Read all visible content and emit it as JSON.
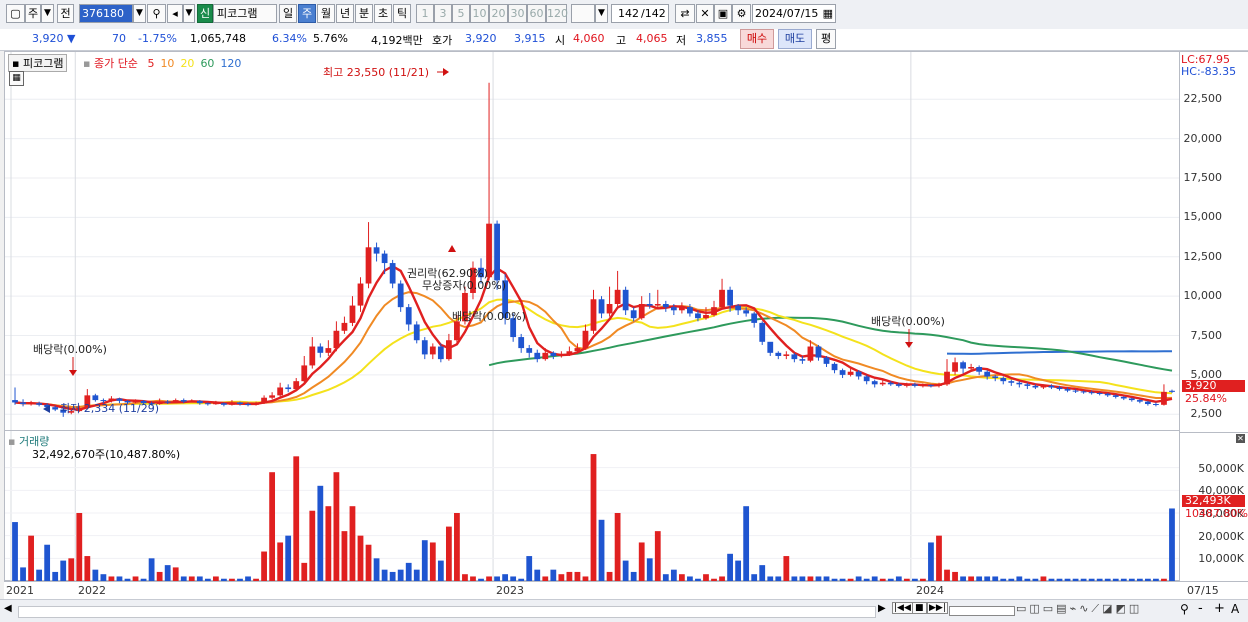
{
  "toolbar": {
    "period_week": "주",
    "prev_label": "전",
    "stock_code": "376180",
    "credit_badge": "신",
    "stock_name": "피코그램",
    "periods": [
      "일",
      "주",
      "월",
      "년",
      "분",
      "초",
      "틱"
    ],
    "active_period": "주",
    "intervals": [
      "1",
      "3",
      "5",
      "10",
      "20",
      "30",
      "60",
      "120"
    ],
    "count": "142",
    "count_total": "/142",
    "date": "2024/07/15"
  },
  "quote": {
    "price": "3,920",
    "direction": "▼",
    "change": "70",
    "change_pct": "-1.75%",
    "volume": "1,065,748",
    "turnover_pct": "6.34%",
    "pct2": "5.76%",
    "amount": "4,192백만",
    "ask_label": "호가",
    "ask": "3,920",
    "bid": "3,915",
    "open_label": "시",
    "open": "4,060",
    "high_label": "고",
    "high": "4,065",
    "low_label": "저",
    "low": "3,855",
    "buy_button": "매수",
    "sell_button": "매도",
    "eval_button": "평"
  },
  "chart": {
    "name_tab": "피코그램",
    "ma_label": "종가 단순",
    "ma_periods": [
      "5",
      "10",
      "20",
      "60",
      "120"
    ],
    "ma_colors": [
      "#e02020",
      "#f08a24",
      "#f4e21c",
      "#2e9a5c",
      "#2f6fd0"
    ],
    "max_annotation": "최고 23,550 (11/21)",
    "min_annotation": "최저 2,334 (11/29)",
    "annotations": [
      "배당락(0.00%)",
      "권리락(62.90%)",
      "무상증자(0.00%)",
      "배당락(0.00%)",
      "배당락(0.00%)"
    ],
    "lc": "LC:67.95",
    "hc": "HC:-83.35",
    "current_price_tag": "3,920",
    "current_pct_tag": "25.84%",
    "volume_title": "거래량",
    "volume_value": "32,492,670주(10,487.80%)",
    "volume_tag": "32,493K",
    "volume_pct_tag": "10487.80%"
  },
  "chart_data": {
    "type": "candlestick",
    "title": "피코그램",
    "price_ticks": [
      "22,500",
      "20,000",
      "17,500",
      "15,000",
      "12,500",
      "10,000",
      "7,500",
      "5,000",
      "2,500"
    ],
    "volume_ticks": [
      "50,000K",
      "40,000K",
      "30,000K",
      "20,000K",
      "10,000K"
    ],
    "x_labels": [
      "2021",
      "2022",
      "2023",
      "2024",
      "07/15"
    ],
    "ylim": [
      1500,
      25500
    ],
    "candles": [
      [
        3400,
        3250,
        4200,
        3100
      ],
      [
        3250,
        3150,
        3450,
        3000
      ],
      [
        3150,
        3200,
        3350,
        3050
      ],
      [
        3200,
        3100,
        3300,
        3000
      ],
      [
        3100,
        2950,
        3200,
        2850
      ],
      [
        2950,
        2800,
        3050,
        2700
      ],
      [
        2800,
        2600,
        2900,
        2334
      ],
      [
        2600,
        2700,
        2800,
        2500
      ],
      [
        2700,
        2900,
        3050,
        2650
      ],
      [
        2900,
        3700,
        4100,
        2850
      ],
      [
        3700,
        3400,
        3800,
        3300
      ],
      [
        3400,
        3350,
        3500,
        3200
      ],
      [
        3350,
        3500,
        3650,
        3250
      ],
      [
        3500,
        3350,
        3550,
        3200
      ],
      [
        3350,
        3250,
        3400,
        3150
      ],
      [
        3250,
        3350,
        3450,
        3200
      ],
      [
        3350,
        3200,
        3400,
        3100
      ],
      [
        3200,
        3150,
        3300,
        3050
      ],
      [
        3150,
        3300,
        3500,
        3100
      ],
      [
        3300,
        3250,
        3400,
        3150
      ],
      [
        3250,
        3400,
        3500,
        3200
      ],
      [
        3400,
        3300,
        3500,
        3200
      ],
      [
        3300,
        3350,
        3450,
        3250
      ],
      [
        3350,
        3200,
        3400,
        3100
      ],
      [
        3200,
        3150,
        3250,
        3050
      ],
      [
        3150,
        3200,
        3350,
        3100
      ],
      [
        3200,
        3100,
        3250,
        3000
      ],
      [
        3100,
        3250,
        3400,
        3050
      ],
      [
        3250,
        3150,
        3300,
        3050
      ],
      [
        3150,
        3100,
        3250,
        3000
      ],
      [
        3100,
        3200,
        3300,
        3050
      ],
      [
        3200,
        3550,
        3700,
        3150
      ],
      [
        3550,
        3700,
        3900,
        3450
      ],
      [
        3700,
        4200,
        4500,
        3600
      ],
      [
        4200,
        4100,
        4400,
        3900
      ],
      [
        4100,
        4600,
        4800,
        4000
      ],
      [
        4600,
        5600,
        6200,
        4500
      ],
      [
        5600,
        6800,
        7400,
        5400
      ],
      [
        6800,
        6400,
        7000,
        6100
      ],
      [
        6400,
        6700,
        7200,
        6200
      ],
      [
        6700,
        7800,
        8400,
        6500
      ],
      [
        7800,
        8300,
        8700,
        7600
      ],
      [
        8300,
        9400,
        10000,
        8100
      ],
      [
        9400,
        10800,
        11200,
        9000
      ],
      [
        10800,
        13100,
        14700,
        10500
      ],
      [
        13100,
        12700,
        13400,
        12200
      ],
      [
        12700,
        12100,
        12900,
        11400
      ],
      [
        12100,
        10800,
        12300,
        10500
      ],
      [
        10800,
        9300,
        11000,
        9000
      ],
      [
        9300,
        8200,
        9500,
        7800
      ],
      [
        8200,
        7200,
        8400,
        7000
      ],
      [
        7200,
        6300,
        7400,
        6000
      ],
      [
        6300,
        6800,
        7000,
        6000
      ],
      [
        6800,
        6000,
        7000,
        5800
      ],
      [
        6000,
        7200,
        7600,
        5900
      ],
      [
        7200,
        8400,
        8800,
        7000
      ],
      [
        8400,
        10200,
        10600,
        8200
      ],
      [
        10200,
        11800,
        12200,
        9800
      ],
      [
        11800,
        11200,
        12400,
        10800
      ],
      [
        11200,
        14600,
        23550,
        11000
      ],
      [
        14600,
        11000,
        14800,
        10400
      ],
      [
        11000,
        8600,
        11400,
        8200
      ],
      [
        8600,
        7400,
        8900,
        7100
      ],
      [
        7400,
        6700,
        7600,
        6400
      ],
      [
        6700,
        6400,
        6900,
        6100
      ],
      [
        6400,
        6000,
        6600,
        5800
      ],
      [
        6000,
        6400,
        6700,
        5900
      ],
      [
        6400,
        6200,
        6500,
        6000
      ],
      [
        6200,
        6300,
        6500,
        6100
      ],
      [
        6300,
        6500,
        6800,
        6200
      ],
      [
        6500,
        6700,
        7000,
        6400
      ],
      [
        6700,
        7800,
        8200,
        6600
      ],
      [
        7800,
        9800,
        10400,
        7600
      ],
      [
        9800,
        8900,
        10000,
        8600
      ],
      [
        8900,
        9500,
        10600,
        8700
      ],
      [
        9500,
        10400,
        11600,
        9300
      ],
      [
        10400,
        9100,
        10600,
        8800
      ],
      [
        9100,
        8600,
        9300,
        8400
      ],
      [
        8600,
        9500,
        10000,
        8500
      ],
      [
        9500,
        9400,
        10200,
        9200
      ],
      [
        9400,
        9500,
        10400,
        9200
      ],
      [
        9500,
        9300,
        9700,
        9000
      ],
      [
        9300,
        9100,
        9500,
        8800
      ],
      [
        9100,
        9300,
        9600,
        8900
      ],
      [
        9300,
        8900,
        9500,
        8700
      ],
      [
        8900,
        8600,
        9100,
        8400
      ],
      [
        8600,
        8800,
        9300,
        8500
      ],
      [
        8800,
        9300,
        9700,
        8700
      ],
      [
        9300,
        10400,
        11100,
        9200
      ],
      [
        10400,
        9400,
        10600,
        9000
      ],
      [
        9400,
        9100,
        9500,
        8800
      ],
      [
        9100,
        8900,
        9300,
        8700
      ],
      [
        8900,
        8300,
        9000,
        8000
      ],
      [
        8300,
        7100,
        8400,
        6900
      ],
      [
        7100,
        6400,
        6900,
        6200
      ],
      [
        6400,
        6200,
        6500,
        6000
      ],
      [
        6200,
        6300,
        6500,
        6000
      ],
      [
        6300,
        6000,
        6400,
        5800
      ],
      [
        6000,
        5900,
        6200,
        5700
      ],
      [
        5900,
        6800,
        7200,
        5800
      ],
      [
        6800,
        6100,
        6900,
        5900
      ],
      [
        6100,
        5700,
        6200,
        5500
      ],
      [
        5700,
        5300,
        5800,
        5100
      ],
      [
        5300,
        5000,
        5400,
        4800
      ],
      [
        5000,
        5200,
        5500,
        4900
      ],
      [
        5200,
        4900,
        5300,
        4700
      ],
      [
        4900,
        4600,
        5000,
        4400
      ],
      [
        4600,
        4400,
        4700,
        4200
      ],
      [
        4400,
        4500,
        4700,
        4300
      ],
      [
        4500,
        4400,
        4600,
        4300
      ],
      [
        4400,
        4300,
        4500,
        4200
      ],
      [
        4300,
        4400,
        4500,
        4200
      ],
      [
        4400,
        4300,
        4500,
        4200
      ],
      [
        4300,
        4350,
        4450,
        4200
      ],
      [
        4350,
        4300,
        4400,
        4200
      ],
      [
        4300,
        4400,
        4500,
        4200
      ],
      [
        4400,
        5200,
        6000,
        4300
      ],
      [
        5200,
        5800,
        6100,
        5000
      ],
      [
        5800,
        5400,
        5900,
        5100
      ],
      [
        5400,
        5500,
        5700,
        5200
      ],
      [
        5500,
        5200,
        5600,
        5000
      ],
      [
        5200,
        4900,
        5300,
        4700
      ],
      [
        4900,
        4800,
        5000,
        4600
      ],
      [
        4800,
        4600,
        4900,
        4400
      ],
      [
        4600,
        4500,
        4700,
        4300
      ],
      [
        4500,
        4400,
        4600,
        4200
      ],
      [
        4400,
        4300,
        4500,
        4100
      ],
      [
        4300,
        4200,
        4400,
        4100
      ],
      [
        4200,
        4300,
        4400,
        4100
      ],
      [
        4300,
        4200,
        4400,
        4100
      ],
      [
        4200,
        4100,
        4300,
        4000
      ],
      [
        4100,
        4000,
        4200,
        3900
      ],
      [
        4000,
        3950,
        4100,
        3850
      ],
      [
        3950,
        3900,
        4000,
        3800
      ],
      [
        3900,
        3850,
        4000,
        3750
      ],
      [
        3850,
        3800,
        3900,
        3700
      ],
      [
        3800,
        3700,
        3850,
        3600
      ],
      [
        3700,
        3600,
        3750,
        3500
      ],
      [
        3600,
        3500,
        3650,
        3400
      ],
      [
        3500,
        3400,
        3550,
        3300
      ],
      [
        3400,
        3300,
        3450,
        3200
      ],
      [
        3300,
        3150,
        3350,
        3050
      ],
      [
        3150,
        3100,
        3250,
        3000
      ],
      [
        3100,
        3920,
        4400,
        3050
      ],
      [
        3990,
        3920,
        4065,
        3855
      ]
    ],
    "volumes": [
      26,
      6,
      20,
      5,
      16,
      4,
      9,
      10,
      30,
      11,
      5,
      3,
      2,
      2,
      1,
      2,
      1,
      10,
      4,
      7,
      6,
      2,
      2,
      2,
      1,
      2,
      1,
      1,
      1,
      2,
      1,
      13,
      48,
      17,
      20,
      55,
      8,
      31,
      42,
      33,
      48,
      22,
      33,
      20,
      16,
      10,
      5,
      4,
      5,
      8,
      5,
      18,
      17,
      9,
      24,
      30,
      3,
      2,
      1,
      2,
      2,
      3,
      2,
      1,
      11,
      5,
      2,
      5,
      3,
      4,
      4,
      2,
      56,
      27,
      4,
      30,
      9,
      4,
      17,
      10,
      22,
      3,
      5,
      3,
      2,
      1,
      3,
      1,
      2,
      12,
      9,
      33,
      3,
      7,
      2,
      2,
      11,
      2,
      2,
      2,
      2,
      2,
      1,
      1,
      1,
      2,
      1,
      2,
      1,
      1,
      2,
      1,
      1,
      1,
      17,
      20,
      5,
      4,
      2,
      2,
      2,
      2,
      2,
      1,
      1,
      2,
      1,
      1,
      2,
      1,
      1,
      1,
      1,
      1,
      1,
      1,
      1,
      1,
      1,
      1,
      1,
      1,
      1,
      1,
      32
    ]
  },
  "status": {
    "nav_buttons": [
      "▶",
      "|◀◀",
      "■",
      "▶▶|"
    ],
    "zoom_out": "-",
    "zoom_in": "+",
    "text_tool": "A"
  }
}
